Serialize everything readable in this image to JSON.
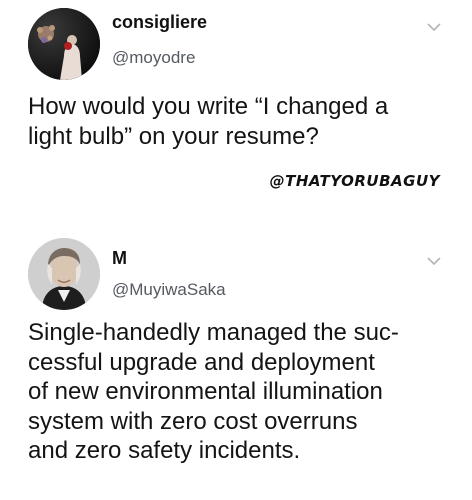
{
  "tweets": [
    {
      "display_name": "consigliere",
      "handle": "@moyodre",
      "text_lines": [
        "How would you write “I changed a",
        "light bulb” on your resume?"
      ],
      "menu_icon": "chevron-down-icon",
      "avatar_icon": "avatar-photo"
    },
    {
      "display_name": "M",
      "handle": "@MuyiwaSaka",
      "text_lines": [
        "Single-handedly managed the suc-",
        "cessful upgrade and deployment",
        "of new environmental illumination",
        "system with zero cost overruns",
        "and zero safety incidents."
      ],
      "menu_icon": "chevron-down-icon",
      "avatar_icon": "avatar-photo"
    }
  ],
  "watermark": "@THATYORUBAGUY"
}
